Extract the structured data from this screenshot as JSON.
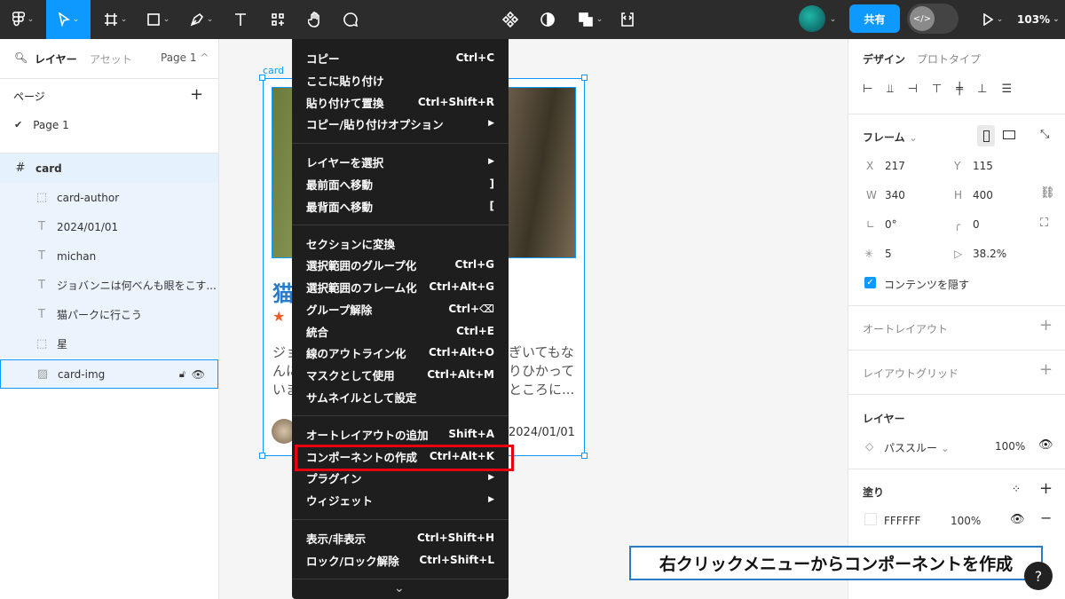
{
  "toolbar": {
    "zoom": "103%",
    "share_label": "共有"
  },
  "left_panel": {
    "tabs": {
      "layers": "レイヤー",
      "assets": "アセット",
      "page": "Page 1"
    },
    "pages_label": "ページ",
    "pages": [
      {
        "label": "Page 1"
      }
    ],
    "layers": [
      {
        "label": "card"
      },
      {
        "label": "card-author"
      },
      {
        "label": "2024/01/01"
      },
      {
        "label": "michan"
      },
      {
        "label": "ジョバンニは何べんも眼をこす..."
      },
      {
        "label": "猫パークに行こう"
      },
      {
        "label": "星"
      },
      {
        "label": "card-img"
      }
    ]
  },
  "canvas": {
    "frame_label": "card",
    "card": {
      "title_fragment": "猫",
      "stars": "★",
      "body_left": [
        "ジョ",
        "んに",
        "いま"
      ],
      "body_right": [
        "ぎいてもな",
        "りひかって",
        "ところに..."
      ],
      "date": "2024/01/01"
    }
  },
  "context_menu": {
    "items": [
      {
        "label": "コピー",
        "shortcut": "Ctrl+C"
      },
      {
        "label": "ここに貼り付け",
        "shortcut": ""
      },
      {
        "label": "貼り付けて置換",
        "shortcut": "Ctrl+Shift+R"
      },
      {
        "label": "コピー/貼り付けオプション",
        "shortcut": "▶"
      },
      {
        "label": "レイヤーを選択",
        "shortcut": "▶"
      },
      {
        "label": "最前面へ移動",
        "shortcut": "]"
      },
      {
        "label": "最背面へ移動",
        "shortcut": "["
      },
      {
        "label": "セクションに変換",
        "shortcut": ""
      },
      {
        "label": "選択範囲のグループ化",
        "shortcut": "Ctrl+G"
      },
      {
        "label": "選択範囲のフレーム化",
        "shortcut": "Ctrl+Alt+G"
      },
      {
        "label": "グループ解除",
        "shortcut": "Ctrl+⌫"
      },
      {
        "label": "統合",
        "shortcut": "Ctrl+E"
      },
      {
        "label": "線のアウトライン化",
        "shortcut": "Ctrl+Alt+O"
      },
      {
        "label": "マスクとして使用",
        "shortcut": "Ctrl+Alt+M"
      },
      {
        "label": "サムネイルとして設定",
        "shortcut": ""
      },
      {
        "label": "オートレイアウトの追加",
        "shortcut": "Shift+A"
      },
      {
        "label": "コンポーネントの作成",
        "shortcut": "Ctrl+Alt+K"
      },
      {
        "label": "プラグイン",
        "shortcut": "▶"
      },
      {
        "label": "ウィジェット",
        "shortcut": "▶"
      },
      {
        "label": "表示/非表示",
        "shortcut": "Ctrl+Shift+H"
      },
      {
        "label": "ロック/ロック解除",
        "shortcut": "Ctrl+Shift+L"
      }
    ],
    "more": "⌄"
  },
  "right_panel": {
    "tabs": {
      "design": "デザイン",
      "prototype": "プロトタイプ"
    },
    "frame_label": "フレーム",
    "x_label": "X",
    "x": "217",
    "y_label": "Y",
    "y": "115",
    "w_label": "W",
    "w": "340",
    "h_label": "H",
    "h": "400",
    "rotation": "0°",
    "radius": "0",
    "count": "5",
    "ratio": "38.2%",
    "clip_label": "コンテンツを隠す",
    "autolayout_label": "オートレイアウト",
    "layoutgrid_label": "レイアウトグリッド",
    "layer_label": "レイヤー",
    "blend_label": "パススルー",
    "opacity": "100%",
    "fill_label": "塗り",
    "fill_hex": "FFFFFF",
    "fill_opacity": "100%"
  },
  "caption": "右クリックメニューからコンポーネントを作成",
  "help_icon": "?"
}
